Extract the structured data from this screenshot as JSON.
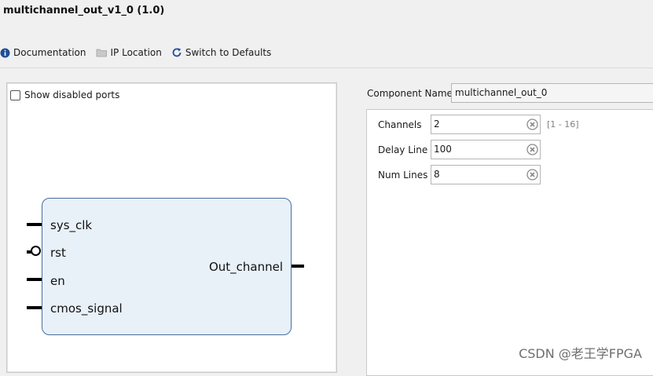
{
  "window": {
    "title": "multichannel_out_v1_0 (1.0)"
  },
  "toolbar": {
    "documentation": "Documentation",
    "ip_location": "IP Location",
    "switch_defaults": "Switch to Defaults"
  },
  "preview": {
    "show_disabled_ports": "Show disabled ports",
    "ports_in": [
      "sys_clk",
      "rst",
      "en",
      "cmos_signal"
    ],
    "port_out": "Out_channel"
  },
  "component": {
    "label": "Component Name",
    "value": "multichannel_out_0"
  },
  "params": [
    {
      "label": "Channels",
      "value": "2",
      "range": "[1 - 16]"
    },
    {
      "label": "Delay Line",
      "value": "100",
      "range": ""
    },
    {
      "label": "Num Lines",
      "value": "8",
      "range": ""
    }
  ],
  "watermark": "CSDN @老王学FPGA",
  "colors": {
    "block_fill": "#e8f0f8",
    "block_border": "#4a6f9a",
    "info_icon": "#1f5aa6",
    "refresh_icon": "#1f5aa6"
  }
}
